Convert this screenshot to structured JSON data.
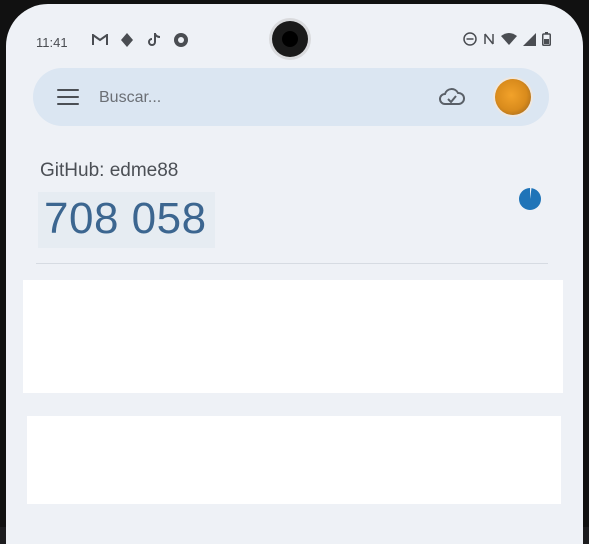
{
  "status_bar": {
    "time": "11:41",
    "left_icons": [
      "gmail-icon",
      "pokemon-go-icon",
      "tiktok-icon",
      "notification-icon"
    ],
    "right_icons": [
      "dnd-icon",
      "nfc-icon",
      "wifi-icon",
      "signal-icon",
      "battery-icon"
    ]
  },
  "search": {
    "placeholder": "Buscar..."
  },
  "accounts": [
    {
      "label": "GitHub: edme88",
      "code": "708 058"
    }
  ],
  "colors": {
    "code": "#3c6690",
    "timer": "#1f74b8",
    "search_bg": "#dbe6f2"
  }
}
